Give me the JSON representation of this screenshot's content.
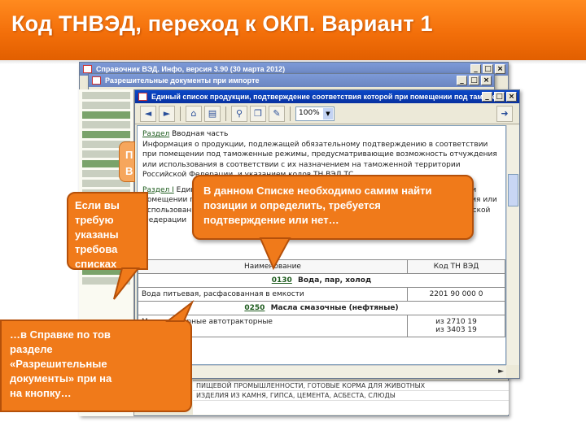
{
  "slide": {
    "title": "Код ТНВЭД, переход к ОКП. Вариант 1"
  },
  "background_windows": {
    "main_title": "Справочник ВЭД. Инфо, версия 3.90 (30 марта 2012)",
    "doc_title": "Разрешительные документы при импорте",
    "bottom_lines": [
      "ПИЩЕВОЙ ПРОМЫШЛЕННОСТИ, ГОТОВЫЕ КОРМА ДЛЯ ЖИВОТНЫХ",
      "ИЗДЕЛИЯ ИЗ КАМНЯ, ГИПСА, ЦЕМЕНТА, АСБЕСТА, СЛЮДЫ"
    ]
  },
  "front_window": {
    "title": "Единый список продукции, подтверждение соответствия которой при помещении под таможе...",
    "zoom": "100%",
    "toolbar_icons": [
      "back-icon",
      "forward-icon",
      "home-icon",
      "print-icon",
      "search-icon",
      "copy-icon",
      "bookmark-icon",
      "export-icon"
    ],
    "doc_lines": {
      "section1_link": "Раздел",
      "section1_heading": "Вводная часть",
      "section1_text": "Информация о продукции, подлежащей обязательному подтверждению в соответствии при помещении под таможенные режимы, предусматривающие возможность отчуждения или использования в соответствии с их назначением на таможенной территории Российской Федерации, и указанием кодов ТН ВЭД ТС.",
      "section2_link": "Раздел I",
      "section2_text": "Единый перечень продукции, подлежащей обязательной сертификации при помещении под таможенные режимы, предусматривающие возможность отчуждения или использования в соответствии с их назначением на таможенной территории Российской Федерации"
    },
    "table": {
      "headers": [
        "Наименование",
        "Код ТН ВЭД"
      ],
      "rows": [
        {
          "type": "group",
          "code": "0130",
          "name": "Вода, пар, холод"
        },
        {
          "type": "item",
          "name": "Вода питьевая, расфасованная в емкости",
          "code": "2201 90 000 0"
        },
        {
          "type": "group",
          "code": "0250",
          "name": "Масла смазочные (нефтяные)"
        },
        {
          "type": "item",
          "name": "Масла моторные автотракторные",
          "code": "из 2710 19\nиз 3403 19"
        }
      ]
    }
  },
  "callouts": {
    "center": "В данном Списке необходимо самим найти позиции и определить, требуется подтверждение или нет…",
    "left_lines": [
      "Если вы",
      "требую",
      "указаны",
      "требова",
      "списках"
    ],
    "bottom_lines": [
      "…в Справке по тов",
      "разделе",
      "«Разрешительные",
      "документы» при на",
      "на кнопку…"
    ],
    "small_lines": [
      "П",
      "В"
    ]
  },
  "colors": {
    "header_orange": "#f36f0a",
    "callout_orange": "#f07a1a",
    "titlebar_blue": "#0a48c8"
  }
}
